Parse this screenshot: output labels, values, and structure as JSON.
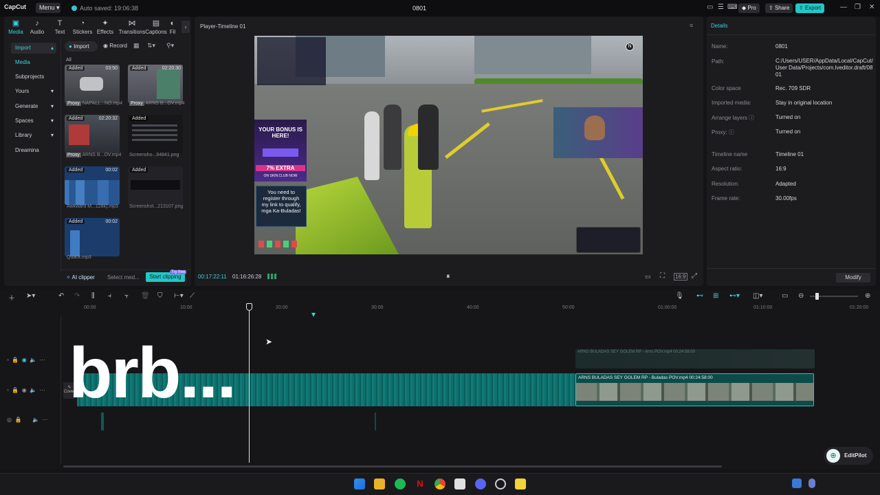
{
  "app": {
    "logo": "CapCut",
    "menu_label": "Menu",
    "autosave_text": "Auto saved: 19:06:38",
    "project_title": "0801",
    "pro_label": "Pro",
    "share_label": "Share",
    "export_label": "Export"
  },
  "left_panel": {
    "tabs": [
      {
        "label": "Media",
        "icon": "media-icon"
      },
      {
        "label": "Audio",
        "icon": "audio-icon"
      },
      {
        "label": "Text",
        "icon": "text-icon"
      },
      {
        "label": "Stickers",
        "icon": "stickers-icon"
      },
      {
        "label": "Effects",
        "icon": "effects-icon"
      },
      {
        "label": "Transitions",
        "icon": "transitions-icon"
      },
      {
        "label": "Captions",
        "icon": "captions-icon"
      },
      {
        "label": "Fil",
        "icon": "filters-icon"
      }
    ],
    "sidenav": [
      "Import",
      "Media",
      "Subprojects",
      "Yours",
      "Generate",
      "Spaces",
      "Library",
      "Dreamina"
    ],
    "import_btn": "Import",
    "record_btn": "Record",
    "filter_all": "All",
    "media": [
      {
        "badge": "Added",
        "duration": "03:50",
        "proxy": "Proxy",
        "name": "NAPALL...NO.mp4"
      },
      {
        "badge": "Added",
        "duration": "02:20:30",
        "proxy": "Proxy",
        "name": "ARNS B...OV.mp4"
      },
      {
        "badge": "Added",
        "duration": "02:20:32",
        "proxy": "Proxy",
        "name": "ARNS B...OV.mp4"
      },
      {
        "badge": "Added",
        "duration": "",
        "proxy": "",
        "name": "Screensho...94841.png"
      },
      {
        "badge": "Added",
        "duration": "00:02",
        "proxy": "",
        "name": "Awkward M...128k).mp3"
      },
      {
        "badge": "Added",
        "duration": "",
        "proxy": "",
        "name": "Screenshot...213107.png"
      },
      {
        "badge": "Added",
        "duration": "00:02",
        "proxy": "",
        "name": "Quack.mp3"
      }
    ],
    "ai_clipper": "AI clipper",
    "select_media": "Select med...",
    "start_clipping": "Start clipping",
    "try_free": "Try free"
  },
  "player": {
    "title": "Player-Timeline 01",
    "current_time": "00:17:22:11",
    "total_time": "01:16:26:28",
    "overlay_bonus_title": "YOUR BONUS IS HERE!",
    "overlay_bonus_extra": "7% EXTRA",
    "overlay_bonus_sub": "ON SKIN.CLUB NOW",
    "overlay_register": "You need to register through my link to qualify, mga Ka-Buladas!"
  },
  "details": {
    "header": "Details",
    "rows": [
      {
        "key": "Name:",
        "value": "0801"
      },
      {
        "key": "Path:",
        "value": "C:/Users/USER/AppData/Local/CapCut/User Data/Projects/com.lveditor.draft/0801"
      },
      {
        "key": "Color space",
        "value": "Rec. 709 SDR"
      },
      {
        "key": "Imported media:",
        "value": "Stay in original location"
      },
      {
        "key": "Arrange layers",
        "value": "Turned on"
      },
      {
        "key": "Proxy:",
        "value": "Turned on"
      },
      {
        "key": "Timeline name",
        "value": "Timeline 01"
      },
      {
        "key": "Aspect ratio:",
        "value": "16:9"
      },
      {
        "key": "Resolution:",
        "value": "Adapted"
      },
      {
        "key": "Frame rate:",
        "value": "30.00fps"
      }
    ],
    "modify_btn": "Modify"
  },
  "timeline": {
    "ruler": [
      "00:00",
      "10:00",
      "20:00",
      "30:00",
      "40:00",
      "50:00",
      "01:00:00",
      "01:10:00",
      "01:20:00"
    ],
    "clip_upper": "ARNS BULADAS SEY GOLEM RP - Arns POV.mp4  00:24:58:00",
    "clip_main": "ARNS BULADAS SEY GOLEM RP - Buladas  POV.mp4   00:24:58:00",
    "cover_label": "Cover",
    "overlay_text": "brb..."
  },
  "editpilot": "EditPilot",
  "colors": {
    "accent": "#22c7c7",
    "track_teal": "#0e6f6c",
    "clip_dark": "#0d4b49"
  }
}
